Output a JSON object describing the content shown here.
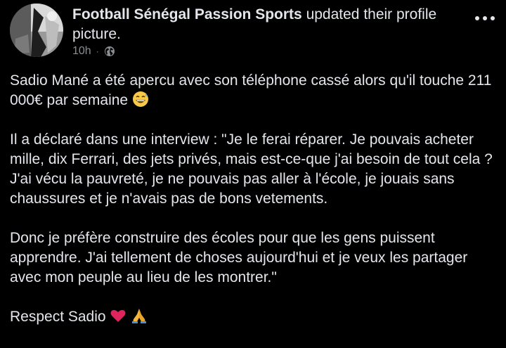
{
  "header": {
    "page_name": "Football Sénégal Passion Sports",
    "action_text": " updated their profile picture.",
    "time": "10h",
    "separator": "·",
    "audience_icon": "globe-icon",
    "more_icon": "more-options-icon"
  },
  "post": {
    "p1": "Sadio Mané a été apercu avec son téléphone cassé alors qu'il touche 211 000€ par semaine",
    "p1_emoji": "grinning-sweat-emoji",
    "p2": "Il a déclaré dans une interview : \"Je le ferai réparer. Je pouvais acheter mille, dix Ferrari, des jets privés, mais est-ce-que j'ai besoin de tout cela ? J'ai vécu la pauvreté, je ne pouvais pas aller à l'école, je jouais sans chaussures et je n'avais pas de bons vetements.",
    "p3": "Donc je préfère construire des écoles pour que les gens puissent apprendre. J'ai tellement de choses aujourd'hui et je veux les partager avec mon peuple au lieu de les montrer.\"",
    "p4": "Respect Sadio",
    "p4_emojis": [
      "red-heart-emoji",
      "folded-hands-emoji"
    ]
  },
  "colors": {
    "background": "#000000",
    "text": "#e4e6eb",
    "secondary_text": "#8a8d91"
  }
}
